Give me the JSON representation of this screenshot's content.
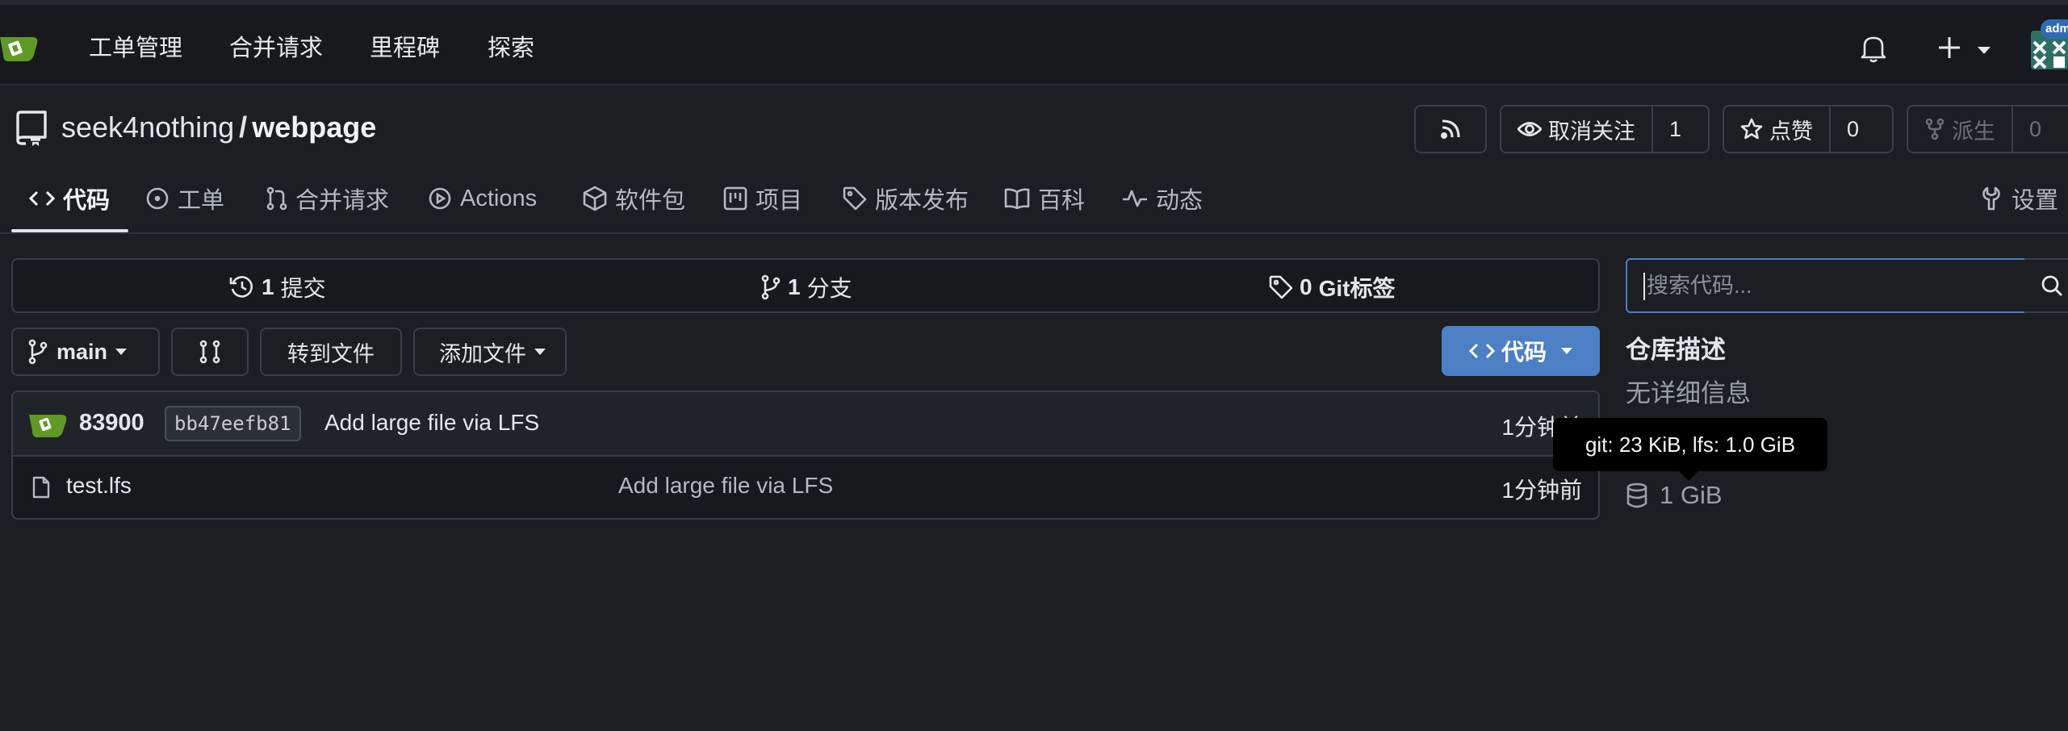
{
  "topnav": {
    "items": [
      "工单管理",
      "合并请求",
      "里程碑",
      "探索"
    ],
    "admin_badge": "adm"
  },
  "repo": {
    "owner": "seek4nothing",
    "separator": "/",
    "name": "webpage",
    "watch_label": "取消关注",
    "watch_count": "1",
    "star_label": "点赞",
    "star_count": "0",
    "fork_label": "派生",
    "fork_count": "0"
  },
  "tabs": {
    "code": "代码",
    "issues": "工单",
    "pulls": "合并请求",
    "actions": "Actions",
    "packages": "软件包",
    "projects": "项目",
    "releases": "版本发布",
    "wiki": "百科",
    "activity": "动态",
    "settings": "设置"
  },
  "stats": {
    "commits_count": "1",
    "commits_label": "提交",
    "branches_count": "1",
    "branches_label": "分支",
    "tags_count": "0",
    "tags_label": "Git标签"
  },
  "toolbar": {
    "branch": "main",
    "goto_file": "转到文件",
    "add_file": "添加文件",
    "clone": "代码"
  },
  "latest_commit": {
    "author": "83900",
    "sha": "bb47eefb81",
    "message": "Add large file via LFS",
    "time": "1分钟前"
  },
  "files": [
    {
      "name": "test.lfs",
      "commit": "Add large file via LFS",
      "time": "1分钟前"
    }
  ],
  "sidebar": {
    "search_placeholder": "搜索代码...",
    "description_heading": "仓库描述",
    "description": "无详细信息",
    "size": "1 GiB",
    "tooltip": "git: 23 KiB, lfs: 1.0 GiB"
  },
  "colors": {
    "accent": "#4c7fc4",
    "background": "#1c1e22",
    "logo_green": "#609926"
  }
}
